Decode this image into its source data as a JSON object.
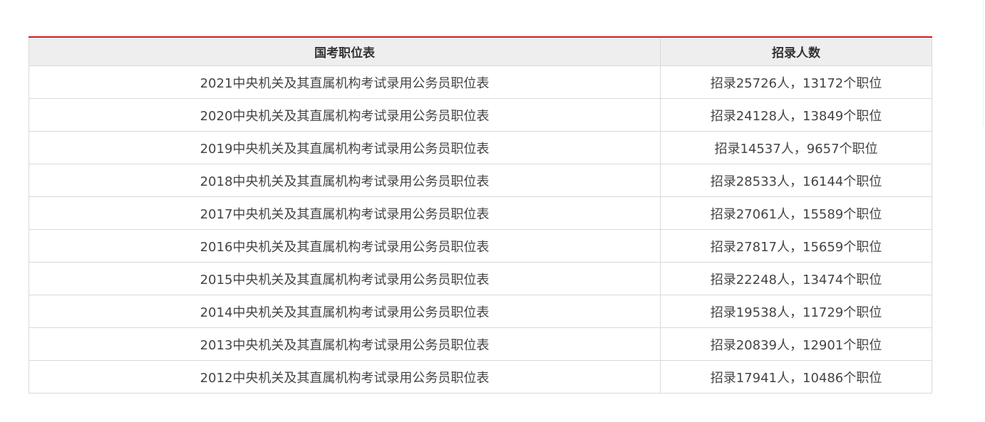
{
  "table": {
    "headers": {
      "position_table": "国考职位表",
      "recruit_count": "招录人数"
    },
    "rows": [
      {
        "title": "2021中央机关及其直属机构考试录用公务员职位表",
        "count": "招录25726人，13172个职位"
      },
      {
        "title": "2020中央机关及其直属机构考试录用公务员职位表",
        "count": "招录24128人，13849个职位"
      },
      {
        "title": "2019中央机关及其直属机构考试录用公务员职位表",
        "count": "招录14537人，9657个职位"
      },
      {
        "title": "2018中央机关及其直属机构考试录用公务员职位表",
        "count": "招录28533人，16144个职位"
      },
      {
        "title": "2017中央机关及其直属机构考试录用公务员职位表",
        "count": "招录27061人，15589个职位"
      },
      {
        "title": "2016中央机关及其直属机构考试录用公务员职位表",
        "count": "招录27817人，15659个职位"
      },
      {
        "title": "2015中央机关及其直属机构考试录用公务员职位表",
        "count": "招录22248人，13474个职位"
      },
      {
        "title": "2014中央机关及其直属机构考试录用公务员职位表",
        "count": "招录19538人，11729个职位"
      },
      {
        "title": "2013中央机关及其直属机构考试录用公务员职位表",
        "count": "招录20839人，12901个职位"
      },
      {
        "title": "2012中央机关及其直属机构考试录用公务员职位表",
        "count": "招录17941人，10486个职位"
      }
    ]
  },
  "colors": {
    "accent_border": "#d7191b",
    "header_bg": "#eeeeee",
    "cell_border": "#d9d9d9",
    "text": "#444444"
  }
}
